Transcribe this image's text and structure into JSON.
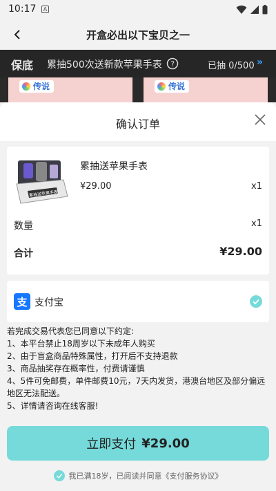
{
  "status": {
    "time": "10:17",
    "notif_letter": "A"
  },
  "nav": {
    "title": "开盒必出以下宝贝之一"
  },
  "banner": {
    "badge": "保底",
    "text": "累抽500次送新款苹果手表",
    "count": "已抽 0/500",
    "arrow": "»"
  },
  "background_cards": [
    {
      "legend": "传说"
    },
    {
      "legend": "传说"
    }
  ],
  "sheet": {
    "title": "确认订单",
    "product": {
      "name": "累抽送苹果手表",
      "price": "¥29.00",
      "qty": "x1",
      "image_caption": "累抽送苹果手表"
    },
    "quantity": {
      "label": "数量",
      "value": "x1"
    },
    "total": {
      "label": "合计",
      "value": "¥29.00"
    },
    "payment": {
      "method": "支付宝",
      "icon_glyph": "支",
      "selected": true
    },
    "terms": [
      "若完成交易代表您已同意以下约定:",
      "1、本平台禁止18周岁以下未成年人购买",
      "2、由于盲盒商品特殊属性，打开后不支持退款",
      "3、商品抽奖存在概率性，付费请谨慎",
      "4、5件可免邮费，单件邮费10元，7天内发货，港澳台地区及部分偏远地区无法配送。",
      "5、详情请咨询在线客服!"
    ],
    "pay_button": {
      "label": "立即支付",
      "amount": "¥29.00"
    },
    "agreement": "我已满18岁，已阅读并同意《支付服务协议》"
  },
  "colors": {
    "accent": "#75dad9",
    "banner_bg": "#262626",
    "alipay": "#1677ff",
    "banner_arrow": "#3aa0ff"
  }
}
